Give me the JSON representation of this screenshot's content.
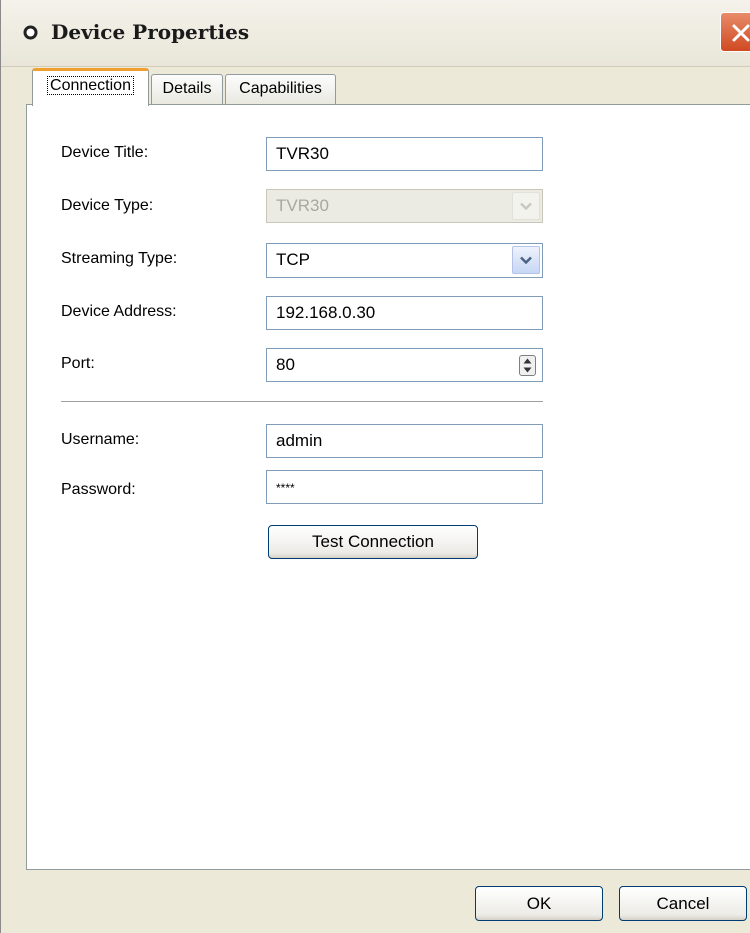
{
  "window": {
    "title": "Device Properties"
  },
  "tabs": [
    {
      "label": "Connection",
      "active": true
    },
    {
      "label": "Details",
      "active": false
    },
    {
      "label": "Capabilities",
      "active": false
    }
  ],
  "form": {
    "device_title": {
      "label": "Device Title:",
      "value": "TVR30"
    },
    "device_type": {
      "label": "Device Type:",
      "value": "TVR30",
      "disabled": true
    },
    "streaming_type": {
      "label": "Streaming Type:",
      "value": "TCP"
    },
    "device_address": {
      "label": "Device Address:",
      "value": "192.168.0.30"
    },
    "port": {
      "label": "Port:",
      "value": "80"
    },
    "username": {
      "label": "Username:",
      "value": "admin"
    },
    "password": {
      "label": "Password:",
      "value": "****"
    }
  },
  "buttons": {
    "test_connection": "Test Connection",
    "ok": "OK",
    "cancel": "Cancel"
  },
  "icons": {
    "title": "device-icon",
    "close": "close-icon",
    "dropdown": "chevron-down-icon",
    "spinner": "spinner-arrows-icon"
  },
  "colors": {
    "dialog_background": "#ece9d8",
    "close_button": "#cf4a22",
    "active_tab_accent": "#f0a030",
    "button_border": "#003c74",
    "field_border": "#7f9db9"
  }
}
